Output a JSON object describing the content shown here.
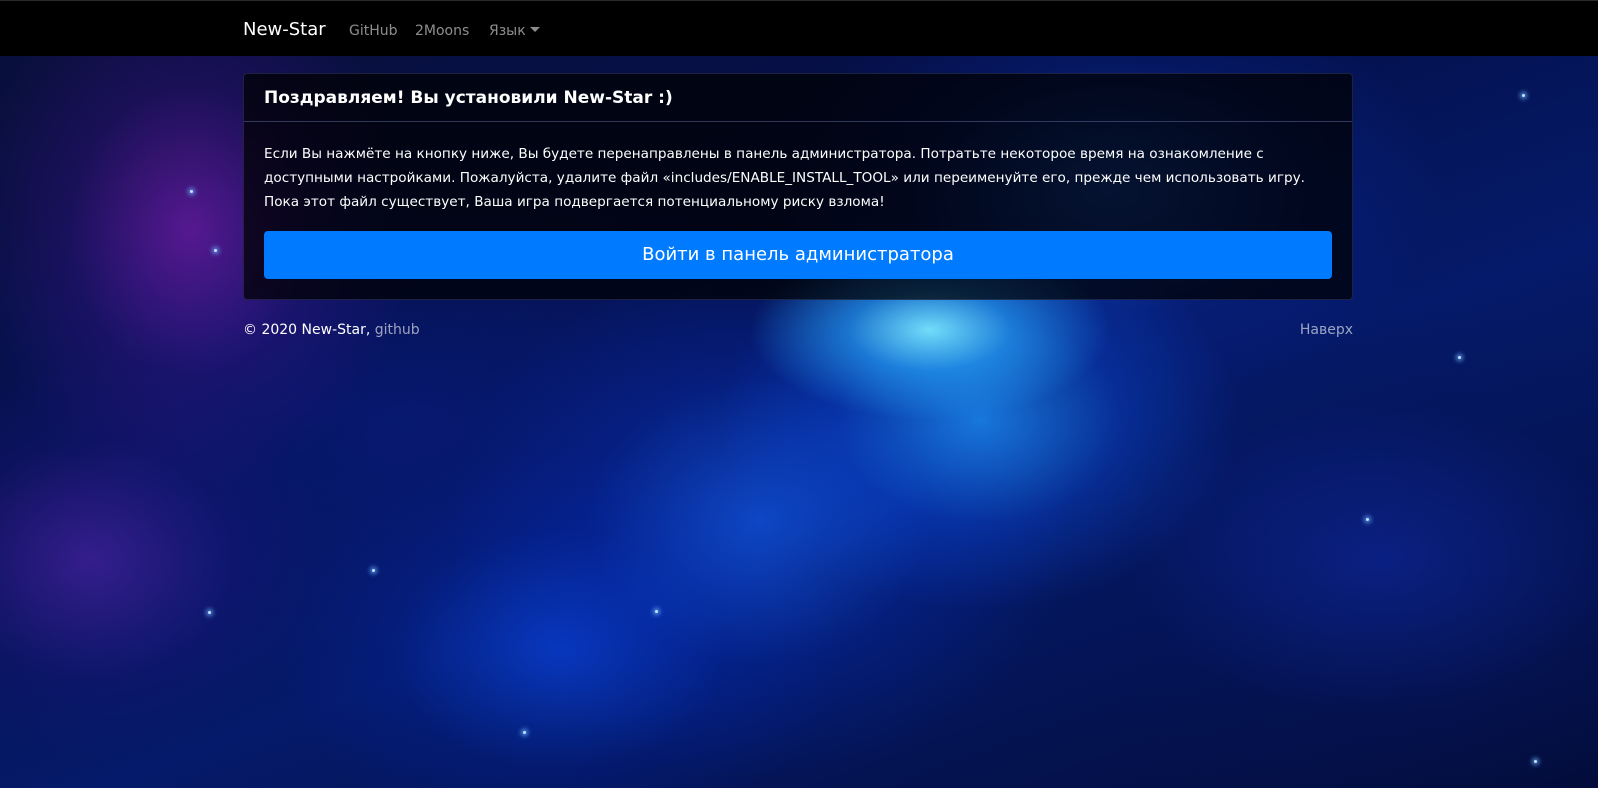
{
  "navbar": {
    "brand": "New-Star",
    "links": [
      "GitHub",
      "2Moons"
    ],
    "language_label": "Язык"
  },
  "card": {
    "title": "Поздравляем! Вы установили New-Star :)",
    "lines": [
      "Если Вы нажмёте на кнопку ниже, Вы будете перенаправлены в панель администратора. Потратьте некоторое время на ознакомление с",
      "доступными настройками. Пожалуйста, удалите файл «includes/ENABLE_INSTALL_TOOL» или переименуйте его, прежде чем использовать игру.",
      "Пока этот файл существует, Ваша игра подвергается потенциальному риску взлома!"
    ],
    "button_label": "Войти в панель администратора"
  },
  "footer": {
    "copyright": "© 2020 New-Star,",
    "link": "github",
    "back_to_top": "Наверх"
  },
  "colors": {
    "primary": "#007bff",
    "navbar_bg": "#000000"
  }
}
